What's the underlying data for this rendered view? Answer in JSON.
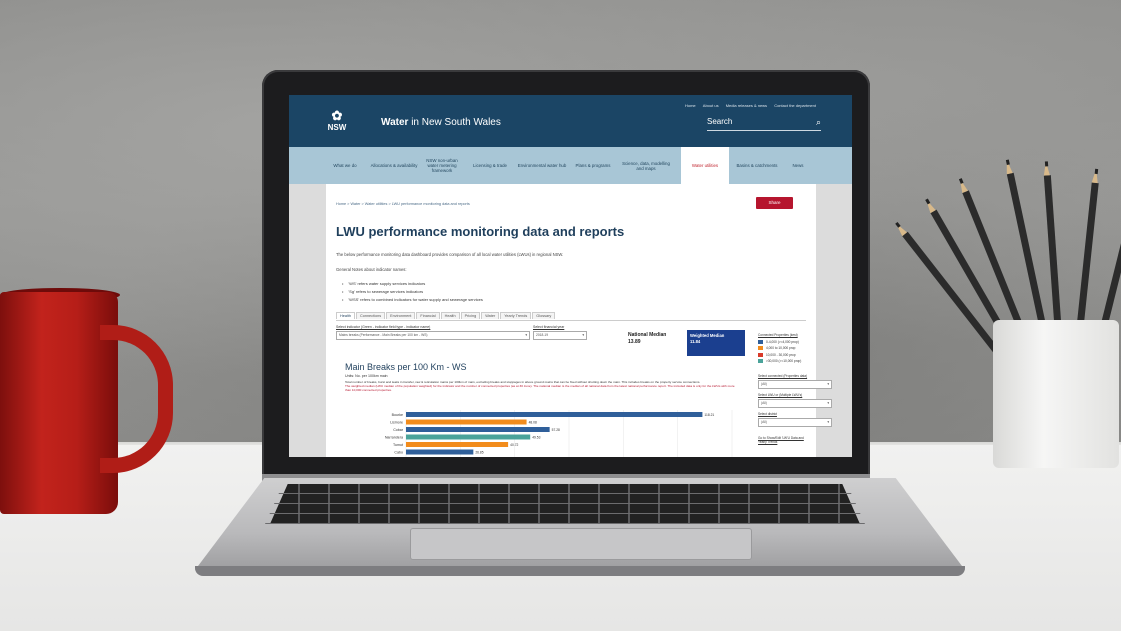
{
  "site": {
    "logo_text": "NSW",
    "title_bold": "Water",
    "title_rest": " in New South Wales",
    "top_links": [
      "Home",
      "About us",
      "Media releases & news",
      "Contact the department"
    ],
    "search_label": "Search"
  },
  "nav": [
    {
      "label": "What we do"
    },
    {
      "label": "Allocations & availability"
    },
    {
      "label": "NSW non-urban water metering framework"
    },
    {
      "label": "Licensing & trade"
    },
    {
      "label": "Environmental water hub"
    },
    {
      "label": "Plans & programs"
    },
    {
      "label": "Science, data, modelling and maps"
    },
    {
      "label": "Water utilities",
      "active": true
    },
    {
      "label": "Basins & catchments"
    },
    {
      "label": "News"
    }
  ],
  "breadcrumb": "Home > Water > Water utilities > LWU performance monitoring data and reports",
  "share_label": "Share",
  "page_title": "LWU performance monitoring data and reports",
  "intro": "The below performance monitoring data dashboard provides comparison of all local water utilities (LWUs) in regional NSW.",
  "notes_heading": "General Notes about indicator names:",
  "bullets": [
    "'WS' refers water supply services indicators",
    "'Sg' refers to sewerage services indicators",
    "'WSS' refers to combined indicators for water supply and sewerage services"
  ],
  "tabs": [
    "Health",
    "Connections",
    "Environment",
    "Financial",
    "Health",
    "Pricing",
    "Water",
    "Yearly Trends",
    "Glossary"
  ],
  "controls": {
    "indicator_label": "Select indicator (Green - indicator field type - indicator name)",
    "indicator_value": "Mains breaks (Performance - Main Breaks per 100 km - WS)",
    "year_label": "Select financial year",
    "year_value": "2018-19",
    "national_median_label": "National Median",
    "national_median_value": "13.89",
    "weighted_median_label": "Weighted Median",
    "weighted_median_value": "11.84"
  },
  "legend": {
    "title": "Connected Properties (kest)",
    "items": [
      {
        "label": "0-4,000 (>=4,000 prop)",
        "color": "#2f5f9a"
      },
      {
        "label": "4,000 to 10,000 prop",
        "color": "#f28c1c"
      },
      {
        "label": "10,000 - 30,000 prop",
        "color": "#d93a2a"
      },
      {
        "label": ">30,000 (>=10,000 prop)",
        "color": "#4aa39a"
      }
    ]
  },
  "side_selects": [
    {
      "label": "Select connected (Properties data)",
      "value": "(All)"
    },
    {
      "label": "Select LWU or (Multiple LWU's)",
      "value": "(All)"
    },
    {
      "label": "Select district",
      "value": "(All)"
    }
  ],
  "side_link": "Go to Show/Edit 'LW'U Data and Yearly Trends",
  "chart_header": {
    "title": "Main Breaks per 100 Km - WS",
    "units": "Units: No. per 100km main",
    "desc": "Total number of breaks, burst and leaks in transfer, raw & reticulation mains per 100km of main, excluding breaks and stoppages in above ground mains that can be fixed without shutting down the main. This includes breaks on the property service connections.",
    "desc_red": "The weighted median (LWU median of the population weighted) for the indicator and the number of connected properties (as at 30 June). The national median is the median of all national data from the latest national performance report. The included data is only for the LWUs with more than 10,000 connected properties."
  },
  "chart_data": {
    "type": "bar",
    "orientation": "horizontal",
    "title": "Main Breaks per 100 Km - WS",
    "categories": [
      "Bourke",
      "Lismore",
      "Cobar",
      "Narrandera",
      "Tumut",
      "Cabo"
    ],
    "values": [
      118.2,
      48.08,
      57.28,
      49.53,
      40.72,
      26.85
    ],
    "value_labels": [
      "118.21",
      "48.08",
      "57.28",
      "49.53",
      "40.72",
      "26.85"
    ],
    "series_colors": [
      "#2f5f9a",
      "#f28c1c",
      "#2f5f9a",
      "#4aa39a",
      "#f28c1c",
      "#2f5f9a"
    ],
    "xlim": [
      0,
      130
    ],
    "grid": true
  }
}
